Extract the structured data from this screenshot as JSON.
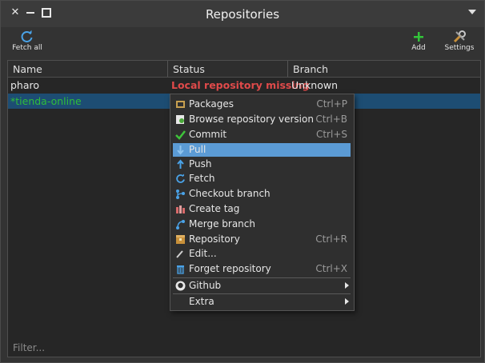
{
  "window": {
    "title": "Repositories"
  },
  "toolbar": {
    "fetch_all": "Fetch all",
    "add": "Add",
    "settings": "Settings"
  },
  "table": {
    "columns": [
      "Name",
      "Status",
      "Branch"
    ],
    "rows": [
      {
        "name": "pharo",
        "status": "Local repository missing",
        "branch": "Unknown"
      },
      {
        "name": "*tienda-online",
        "status": "",
        "branch": ""
      }
    ],
    "filter_placeholder": "Filter..."
  },
  "context_menu": {
    "items": [
      {
        "label": "Packages",
        "shortcut": "Ctrl+P",
        "icon": "package-icon"
      },
      {
        "label": "Browse repository version",
        "shortcut": "Ctrl+B",
        "icon": "browse-icon"
      },
      {
        "label": "Commit",
        "shortcut": "Ctrl+S",
        "icon": "check-icon"
      },
      {
        "label": "Pull",
        "shortcut": "",
        "icon": "pull-icon"
      },
      {
        "label": "Push",
        "shortcut": "",
        "icon": "push-icon"
      },
      {
        "label": "Fetch",
        "shortcut": "",
        "icon": "fetch-icon"
      },
      {
        "label": "Checkout branch",
        "shortcut": "",
        "icon": "branch-icon"
      },
      {
        "label": "Create tag",
        "shortcut": "",
        "icon": "tag-icon"
      },
      {
        "label": "Merge branch",
        "shortcut": "",
        "icon": "merge-icon"
      },
      {
        "label": "Repository",
        "shortcut": "Ctrl+R",
        "icon": "repository-icon"
      },
      {
        "label": "Edit...",
        "shortcut": "",
        "icon": "edit-icon"
      },
      {
        "label": "Forget repository",
        "shortcut": "Ctrl+X",
        "icon": "trash-icon"
      },
      {
        "label": "Github",
        "shortcut": "",
        "icon": "github-icon"
      },
      {
        "label": "Extra",
        "shortcut": "",
        "icon": ""
      }
    ]
  },
  "colors": {
    "status_error": "#e04a4a",
    "dirty_repo": "#2fbd3a",
    "selection_row": "#1d4d73",
    "menu_highlight": "#5b9bd5"
  }
}
